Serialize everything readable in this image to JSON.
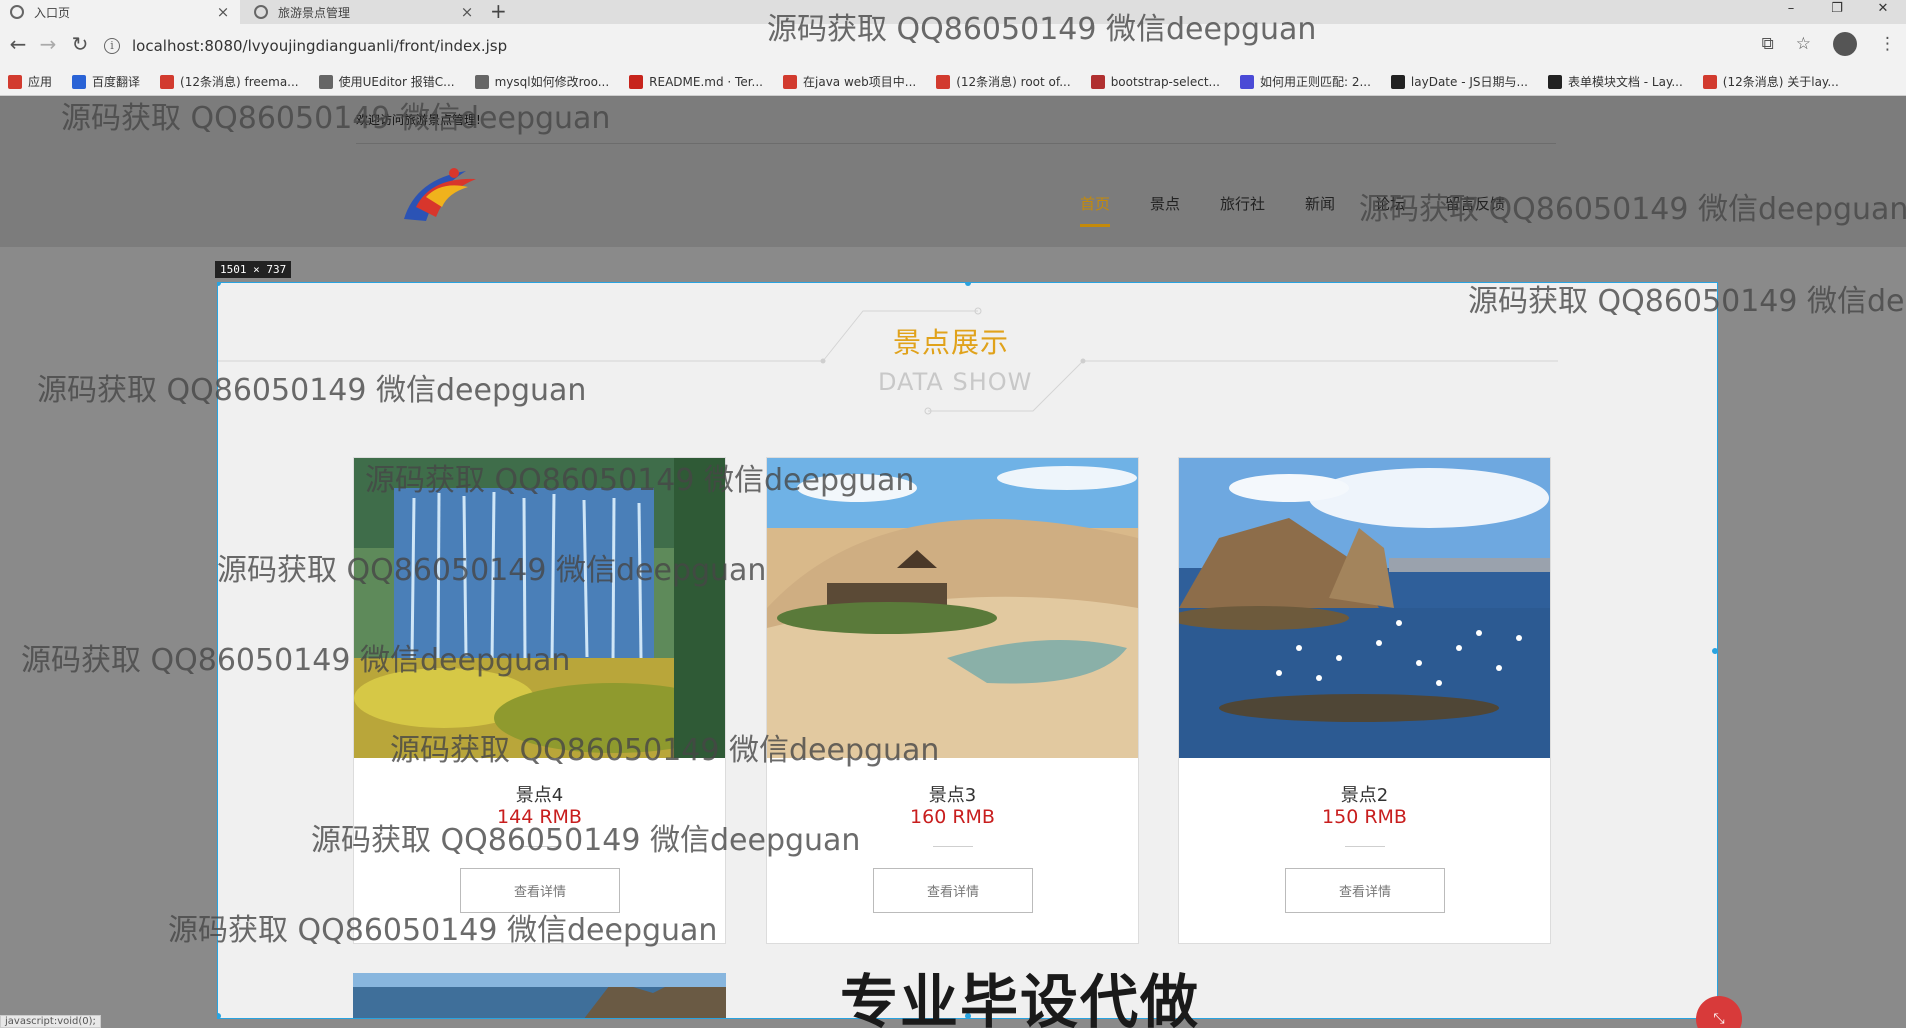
{
  "browser": {
    "tabs": [
      {
        "label": "入口页",
        "close": "×"
      },
      {
        "label": "旅游景点管理",
        "close": "×"
      }
    ],
    "new_tab": "+",
    "window_controls": [
      "–",
      "❐",
      "✕"
    ],
    "url": "localhost:8080/lvyoujingdianguanli/front/index.jsp",
    "back": "←",
    "forward": "→",
    "reload": "↻",
    "bookmarks": [
      {
        "label": "应用",
        "color": "#d23b2f"
      },
      {
        "label": "百度翻译",
        "color": "#2a63d6"
      },
      {
        "label": "(12条消息) freema...",
        "color": "#d23b2f"
      },
      {
        "label": "使用UEditor 报错C...",
        "color": "#666666"
      },
      {
        "label": "mysql如何修改roo...",
        "color": "#666666"
      },
      {
        "label": "README.md · Ter...",
        "color": "#c7241c"
      },
      {
        "label": "在java web项目中...",
        "color": "#d23b2f"
      },
      {
        "label": "(12条消息) root of...",
        "color": "#d23b2f"
      },
      {
        "label": "bootstrap-select...",
        "color": "#b03030"
      },
      {
        "label": "如何用正则匹配: 2...",
        "color": "#4a4ad6"
      },
      {
        "label": "layDate - JS日期与...",
        "color": "#222222"
      },
      {
        "label": "表单模块文档 - Lay...",
        "color": "#222222"
      },
      {
        "label": "(12条消息) 关于lay...",
        "color": "#d23b2f"
      }
    ]
  },
  "site": {
    "welcome": "欢迎访问旅游景点管理!",
    "nav": [
      "首页",
      "景点",
      "旅行社",
      "新闻",
      "论坛",
      "留言反馈"
    ],
    "active_nav": 0
  },
  "inspector": {
    "dimensions": "1501 × 737"
  },
  "section": {
    "title_cn": "景点展示",
    "title_en": "DATA SHOW"
  },
  "cards": [
    {
      "name": "景点4",
      "price": "144 RMB",
      "button": "查看详情"
    },
    {
      "name": "景点3",
      "price": "160 RMB",
      "button": "查看详情"
    },
    {
      "name": "景点2",
      "price": "150 RMB",
      "button": "查看详情"
    }
  ],
  "status_bar": "javascript:void(0);",
  "watermark": "源码获取 QQ86050149 微信deepguan",
  "banner": "专业毕设代做",
  "colors": {
    "accent": "#e0a21b",
    "price": "#c81e1e",
    "highlight_border": "#29a3e0"
  }
}
